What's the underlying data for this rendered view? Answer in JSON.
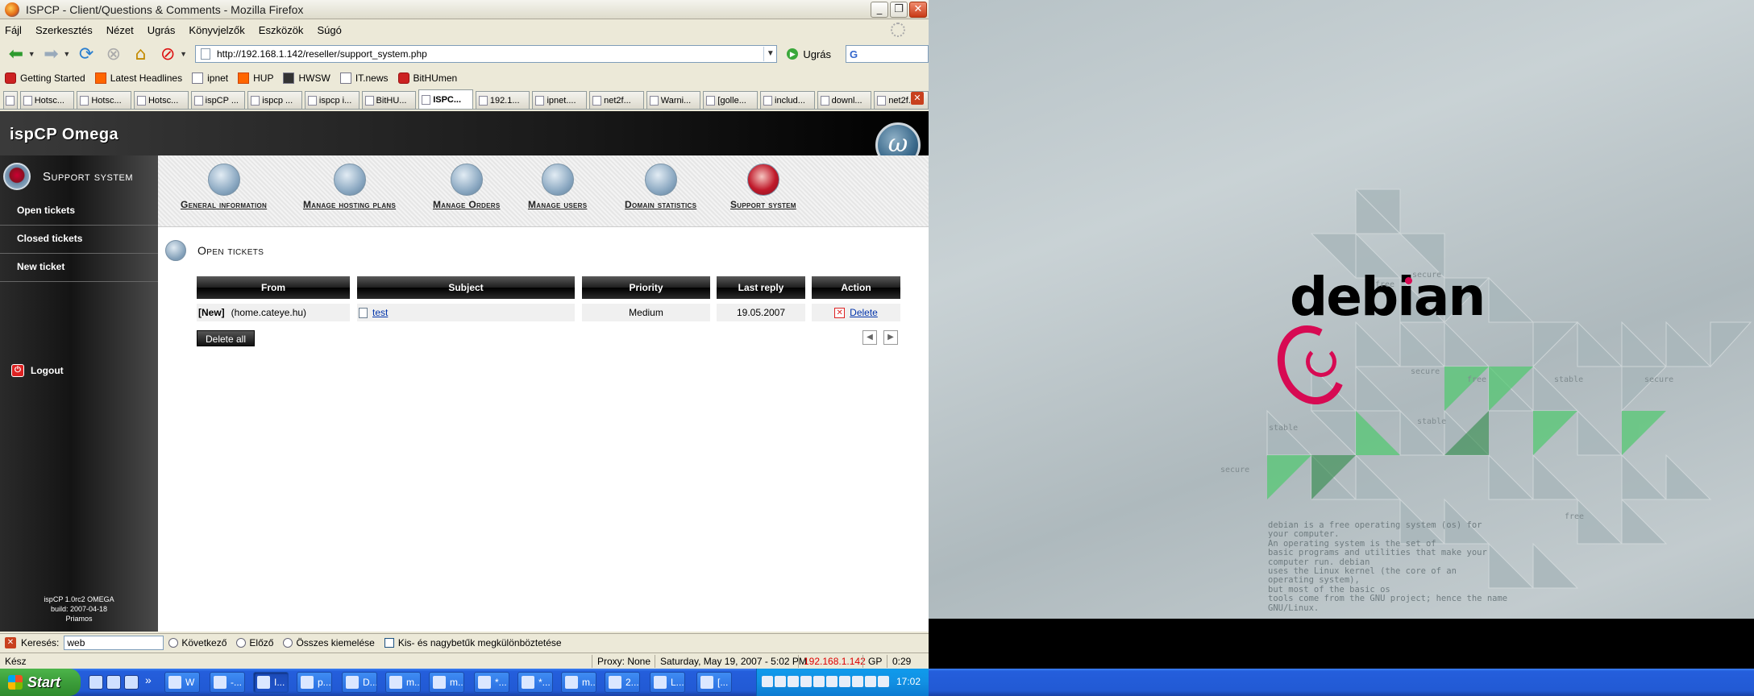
{
  "window": {
    "title": "ISPCP - Client/Questions & Comments - Mozilla Firefox",
    "controls": [
      "_",
      "❐",
      "✕"
    ]
  },
  "menu": [
    "Fájl",
    "Szerkesztés",
    "Nézet",
    "Ugrás",
    "Könyvjelzők",
    "Eszközök",
    "Súgó"
  ],
  "nav": {
    "url": "http://192.168.1.142/reseller/support_system.php",
    "go_label": "Ugrás",
    "search_value": ""
  },
  "bookmarks": [
    "Getting Started",
    "Latest Headlines",
    "ipnet",
    "HUP",
    "HWSW",
    "IT.news",
    "BitHUmen"
  ],
  "tabs": [
    "Hotsc...",
    "Hotsc...",
    "Hotsc...",
    "ispCP ...",
    "ispcp ...",
    "ispcp i...",
    "BitHU...",
    "ISPC...",
    "192.1...",
    "ipnet....",
    "net2f...",
    "Warni...",
    "[golle...",
    "includ...",
    "downl...",
    "net2f..."
  ],
  "page": {
    "logo": "ispCP Omega",
    "emblem": "ω",
    "section_title": "Support system",
    "side_links": [
      "Open tickets",
      "Closed tickets",
      "New ticket"
    ],
    "logout": "Logout",
    "footer": [
      "ispCP 1.0rc2 OMEGA",
      "build: 2007-04-18",
      "Priamos"
    ],
    "tools": [
      "General information",
      "Manage hosting plans",
      "Manage Orders",
      "Manage users",
      "Domain statistics",
      "Support system"
    ],
    "content_title": "Open tickets",
    "table": {
      "headers": [
        "From",
        "Subject",
        "Priority",
        "Last reply",
        "Action"
      ],
      "rows": [
        {
          "status": "[New]",
          "from": "(home.cateye.hu)",
          "subject": "test",
          "priority": "Medium",
          "last_reply": "19.05.2007",
          "action": "Delete"
        }
      ]
    },
    "delete_all": "Delete all",
    "pager_prev": "◀",
    "pager_next": "▶"
  },
  "findbar": {
    "label": "Keresés:",
    "value": "web",
    "next": "Következő",
    "prev": "Előző",
    "highlight": "Összes kiemelése",
    "case": "Kis- és nagybetűk megkülönböztetése"
  },
  "status": {
    "text": "Kész",
    "proxy": "Proxy: None",
    "datetime": "Saturday, May 19, 2007 - 5:02 PM",
    "ip": "192.168.1.142",
    "gp": "GP",
    "timer": "0:29"
  },
  "taskbar": {
    "start": "Start",
    "more": "»",
    "buttons": [
      "W",
      "-...",
      "I...",
      "p...",
      "D...",
      "m...",
      "m...",
      "*...",
      "*...",
      "m...",
      "2...",
      "L...",
      "[..."
    ],
    "clock": "17:02"
  },
  "desktop": {
    "brand": "debian",
    "tagline": [
      "debian is a free operating system (os) for",
      "your computer.",
      "An operating system is the set of",
      "basic programs and utilities that make your",
      "computer run. debian",
      "uses the Linux kernel (the core of an",
      "operating system),",
      "but most of the basic os",
      "tools come from the GNU project; hence the name GNU/Linux."
    ],
    "words": [
      "secure",
      "free",
      "secure",
      "free",
      "stable",
      "secure",
      "stable",
      "stable",
      "secure",
      "free"
    ]
  }
}
